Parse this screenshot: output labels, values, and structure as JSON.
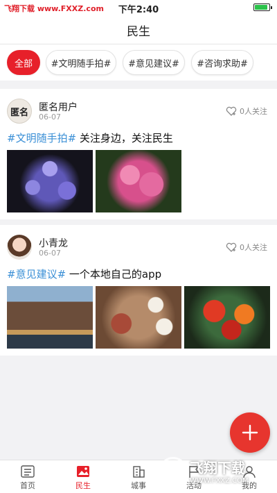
{
  "status_bar": {
    "watermark": "飞翔下载 www.FXXZ.com",
    "time": "下午2:40",
    "battery_level": 0.9
  },
  "header": {
    "title": "民生"
  },
  "filters": [
    {
      "label": "全部",
      "active": true
    },
    {
      "label": "#文明随手拍#",
      "active": false
    },
    {
      "label": "#意见建议#",
      "active": false
    },
    {
      "label": "#咨询求助#",
      "active": false
    }
  ],
  "posts": [
    {
      "avatar_text": "匿名",
      "user": "匿名用户",
      "date": "06-07",
      "follow_label": "0人关注",
      "hashtag": "#文明随手拍#",
      "text": "关注身边，关注民生",
      "photos": [
        "agapanthus-flower-photo",
        "pink-hydrangea-photo"
      ]
    },
    {
      "avatar_text": "",
      "user": "小青龙",
      "date": "06-07",
      "follow_label": "0人关注",
      "hashtag": "#意见建议#",
      "text": "一个本地自己的app",
      "photos": [
        "canal-houses-photo",
        "tea-set-photo",
        "red-flowers-photo"
      ]
    }
  ],
  "tabbar": [
    {
      "label": "首页",
      "icon": "list-icon",
      "active": false
    },
    {
      "label": "民生",
      "icon": "image-icon",
      "active": true
    },
    {
      "label": "城事",
      "icon": "building-icon",
      "active": false
    },
    {
      "label": "活动",
      "icon": "flag-icon",
      "active": false
    },
    {
      "label": "我的",
      "icon": "user-icon",
      "active": false
    }
  ],
  "watermark_overlay": {
    "name": "飞翔下载",
    "url": "WWW.FXXZ.COM"
  },
  "colors": {
    "accent": "#e7202a",
    "hashtag": "#3a8fd6",
    "fab": "#e7352e"
  }
}
